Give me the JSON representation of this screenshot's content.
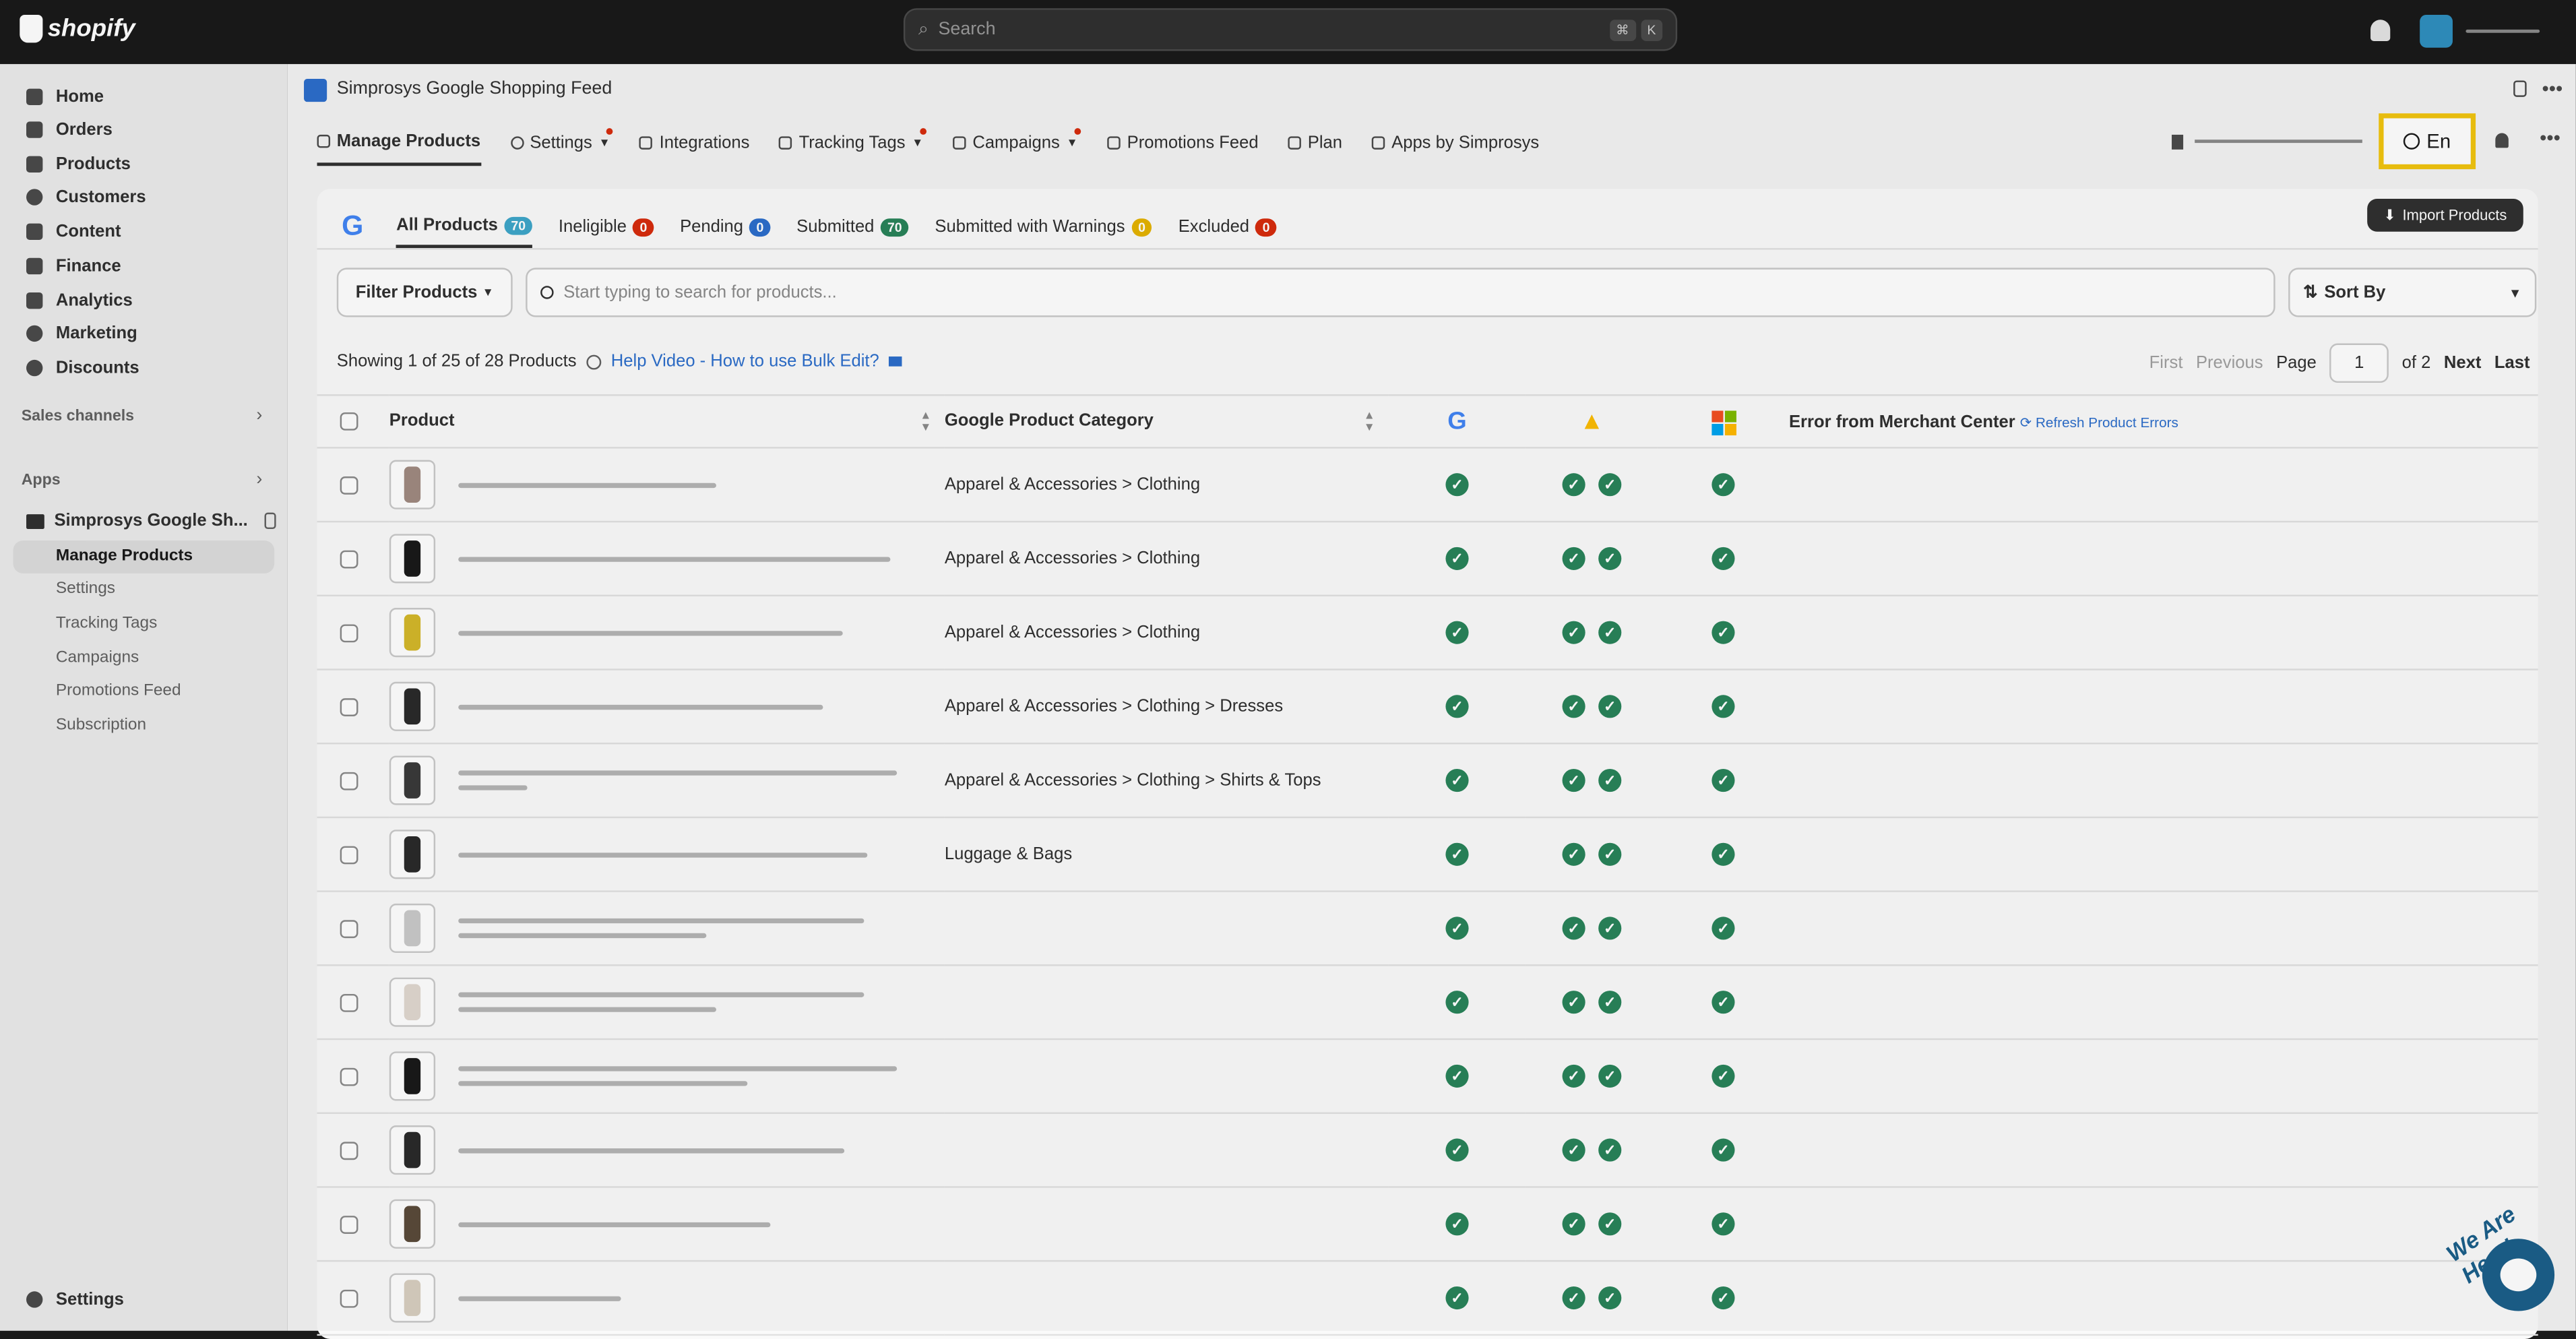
{
  "topbar": {
    "brand": "shopify",
    "search_placeholder": "Search",
    "shortcut": [
      "⌘",
      "K"
    ]
  },
  "sidebar": {
    "items": [
      {
        "label": "Home",
        "icon": "home-icon"
      },
      {
        "label": "Orders",
        "icon": "orders-icon"
      },
      {
        "label": "Products",
        "icon": "tag-icon"
      },
      {
        "label": "Customers",
        "icon": "person-icon"
      },
      {
        "label": "Content",
        "icon": "content-icon"
      },
      {
        "label": "Finance",
        "icon": "bank-icon"
      },
      {
        "label": "Analytics",
        "icon": "chart-icon"
      },
      {
        "label": "Marketing",
        "icon": "target-icon"
      },
      {
        "label": "Discounts",
        "icon": "discount-icon"
      }
    ],
    "sales_channels": "Sales channels",
    "apps": "Apps",
    "app_name": "Simprosys Google Sh...",
    "subitems": [
      "Manage Products",
      "Settings",
      "Tracking Tags",
      "Campaigns",
      "Promotions Feed",
      "Subscription"
    ],
    "settings": "Settings"
  },
  "app": {
    "title": "Simprosys Google Shopping Feed",
    "tabs": [
      "Manage Products",
      "Settings",
      "Integrations",
      "Tracking Tags",
      "Campaigns",
      "Promotions Feed",
      "Plan",
      "Apps by Simprosys"
    ],
    "language": "En"
  },
  "status_tabs": [
    {
      "label": "All Products",
      "count": "70",
      "color": "#3ea6c9"
    },
    {
      "label": "Ineligible",
      "count": "0",
      "color": "#d72c0d"
    },
    {
      "label": "Pending",
      "count": "0",
      "color": "#2c6ecb"
    },
    {
      "label": "Submitted",
      "count": "70",
      "color": "#29845a"
    },
    {
      "label": "Submitted with Warnings",
      "count": "0",
      "color": "#e4b200"
    },
    {
      "label": "Excluded",
      "count": "0",
      "color": "#d72c0d"
    }
  ],
  "import_button": "Import Products",
  "filter_button": "Filter Products",
  "search_placeholder": "Start typing to search for products...",
  "sort_label": "Sort By",
  "showing": "Showing 1 of 25 of 28 Products",
  "help_link": "Help Video - How to use Bulk Edit?",
  "pager": {
    "first": "First",
    "previous": "Previous",
    "page_label": "Page",
    "page": "1",
    "of": "of 2",
    "next": "Next",
    "last": "Last"
  },
  "table": {
    "headers": {
      "product": "Product",
      "category": "Google Product Category",
      "error": "Error from Merchant Center",
      "refresh": "Refresh Product Errors"
    },
    "rows": [
      {
        "category": "Apparel & Accessories > Clothing",
        "thumb": "#a08a80"
      },
      {
        "category": "Apparel & Accessories > Clothing",
        "thumb": "#1a1a1a"
      },
      {
        "category": "Apparel & Accessories > Clothing",
        "thumb": "#d4b82a"
      },
      {
        "category": "Apparel & Accessories > Clothing > Dresses",
        "thumb": "#2a2a2a"
      },
      {
        "category": "Apparel & Accessories > Clothing > Shirts & Tops",
        "thumb": "#3a3a3a"
      },
      {
        "category": "Luggage & Bags",
        "thumb": "#2a2a2a"
      },
      {
        "category": "",
        "thumb": "#c9c9c9"
      },
      {
        "category": "",
        "thumb": "#e0d8d0"
      },
      {
        "category": "",
        "thumb": "#1a1a1a"
      },
      {
        "category": "",
        "thumb": "#2a2a2a"
      },
      {
        "category": "",
        "thumb": "#5a4a3a"
      },
      {
        "category": "",
        "thumb": "#d8cfc0"
      }
    ]
  },
  "chat_badge": "We Are Here!"
}
